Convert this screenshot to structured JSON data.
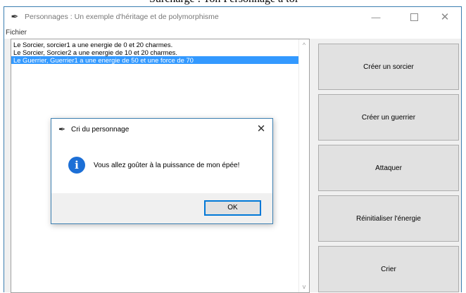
{
  "behind": {
    "text": "Surcharge : Ton Personnage à toi"
  },
  "window": {
    "title": "Personnages : Un exemple d'héritage et de polymorphisme",
    "app_icon": "feather-icon",
    "controls": {
      "minimize": "—",
      "maximize": "□",
      "close": "✕"
    }
  },
  "menu": {
    "items": [
      {
        "label": "Fichier"
      }
    ]
  },
  "list": {
    "items": [
      {
        "text": "Le Sorcier, sorcier1 a une energie de 0 et 20 charmes.",
        "selected": false
      },
      {
        "text": "Le Sorcier, Sorcier2 a une energie de 10 et 20 charmes.",
        "selected": false
      },
      {
        "text": "Le Guerrier, Guerrier1 a une energie de 50 et une force de 70",
        "selected": true
      }
    ],
    "scroll_up": "^",
    "scroll_down": "v"
  },
  "buttons": [
    {
      "label": "Créer un sorcier"
    },
    {
      "label": "Créer un guerrier"
    },
    {
      "label": "Attaquer"
    },
    {
      "label": "Réinitialiser l'énergie"
    },
    {
      "label": "Crier"
    }
  ],
  "dialog": {
    "title": "Cri du personnage",
    "icon": "information-icon",
    "icon_glyph": "i",
    "message": "Vous allez goûter à la puissance de mon épée!",
    "ok_label": "OK",
    "close_glyph": "✕"
  },
  "colors": {
    "selection": "#3399ff",
    "window_border": "#3c7fb1",
    "info_icon": "#1c6fd6",
    "button_face": "#e1e1e1",
    "default_button_border": "#0078d7"
  }
}
